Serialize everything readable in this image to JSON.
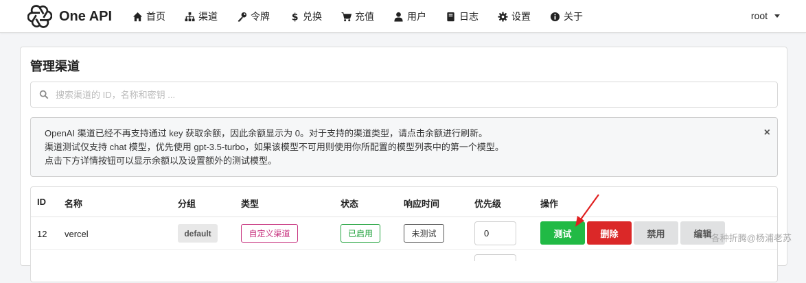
{
  "app": {
    "name": "One API"
  },
  "nav": [
    {
      "label": "首页",
      "icon": "home-icon"
    },
    {
      "label": "渠道",
      "icon": "sitemap-icon"
    },
    {
      "label": "令牌",
      "icon": "key-icon"
    },
    {
      "label": "兑换",
      "icon": "dollar-icon"
    },
    {
      "label": "充值",
      "icon": "cart-icon"
    },
    {
      "label": "用户",
      "icon": "user-icon"
    },
    {
      "label": "日志",
      "icon": "book-icon"
    },
    {
      "label": "设置",
      "icon": "gear-icon"
    },
    {
      "label": "关于",
      "icon": "info-icon"
    }
  ],
  "user": {
    "name": "root"
  },
  "page": {
    "title": "管理渠道",
    "search_placeholder": "搜索渠道的 ID，名称和密钥 ...",
    "notice": [
      "OpenAI 渠道已经不再支持通过 key 获取余额，因此余额显示为 0。对于支持的渠道类型，请点击余额进行刷新。",
      "渠道测试仅支持 chat 模型，优先使用 gpt-3.5-turbo，如果该模型不可用则使用你所配置的模型列表中的第一个模型。",
      "点击下方详情按钮可以显示余额以及设置额外的测试模型。"
    ],
    "notice_close": "×"
  },
  "table": {
    "headers": [
      "ID",
      "名称",
      "分组",
      "类型",
      "状态",
      "响应时间",
      "优先级",
      "操作"
    ],
    "rows": [
      {
        "id": "12",
        "name": "vercel",
        "group": "default",
        "type": "自定义渠道",
        "status": "已启用",
        "response": "未测试",
        "priority": "0",
        "actions": {
          "test": "测试",
          "delete": "删除",
          "disable": "禁用",
          "edit": "编辑"
        }
      }
    ]
  },
  "colors": {
    "test": "#21ba45",
    "delete": "#db2828",
    "type_tag": "#c7327e",
    "status_tag": "#21a23c",
    "arrow": "#e02020"
  },
  "watermark": "各种折腾@杨浦老苏"
}
